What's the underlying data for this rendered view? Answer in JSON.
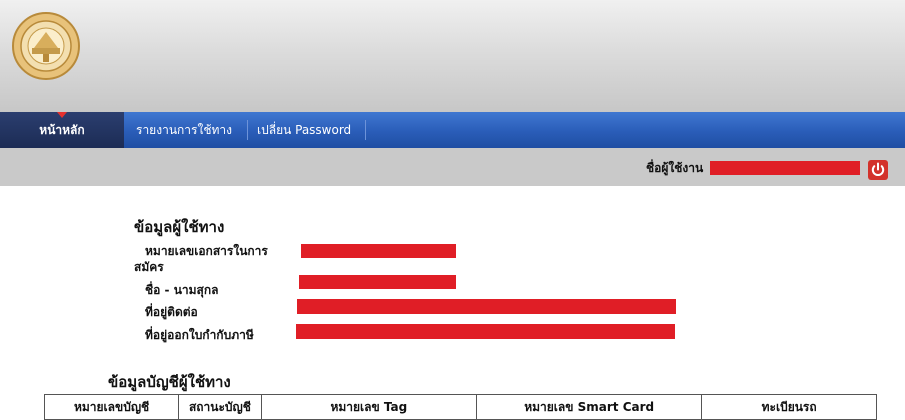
{
  "nav": {
    "items": [
      {
        "label": "หน้าหลัก",
        "active": true
      },
      {
        "label": "รายงานการใช้ทาง",
        "active": false
      },
      {
        "label": "เปลี่ยน Password",
        "active": false
      }
    ]
  },
  "userbar": {
    "label": "ชื่อผู้ใช้งาน",
    "logout_icon": "power-icon"
  },
  "user_info": {
    "title": "ข้อมูลผู้ใช้ทาง",
    "fields": [
      {
        "label_line1": "หมายเลขเอกสารในการ",
        "label_line2": "สมัคร"
      },
      {
        "label": "ชื่อ - นามสุกล"
      },
      {
        "label": "ที่อยู่ติดต่อ"
      },
      {
        "label": "ที่อยู่ออกใบกำกับภาษี"
      }
    ]
  },
  "accounts": {
    "title": "ข้อมูลบัญชีผู้ใช้ทาง",
    "columns": [
      "หมายเลขบัญชี",
      "สถานะบัญชี",
      "หมายเลข Tag",
      "หมายเลข Smart Card",
      "ทะเบียนรถ"
    ]
  },
  "colors": {
    "nav_blue": "#2a5db8",
    "nav_active": "#1c2c55",
    "redaction": "#e01e26",
    "userbar_gray": "#c9c9c9"
  }
}
